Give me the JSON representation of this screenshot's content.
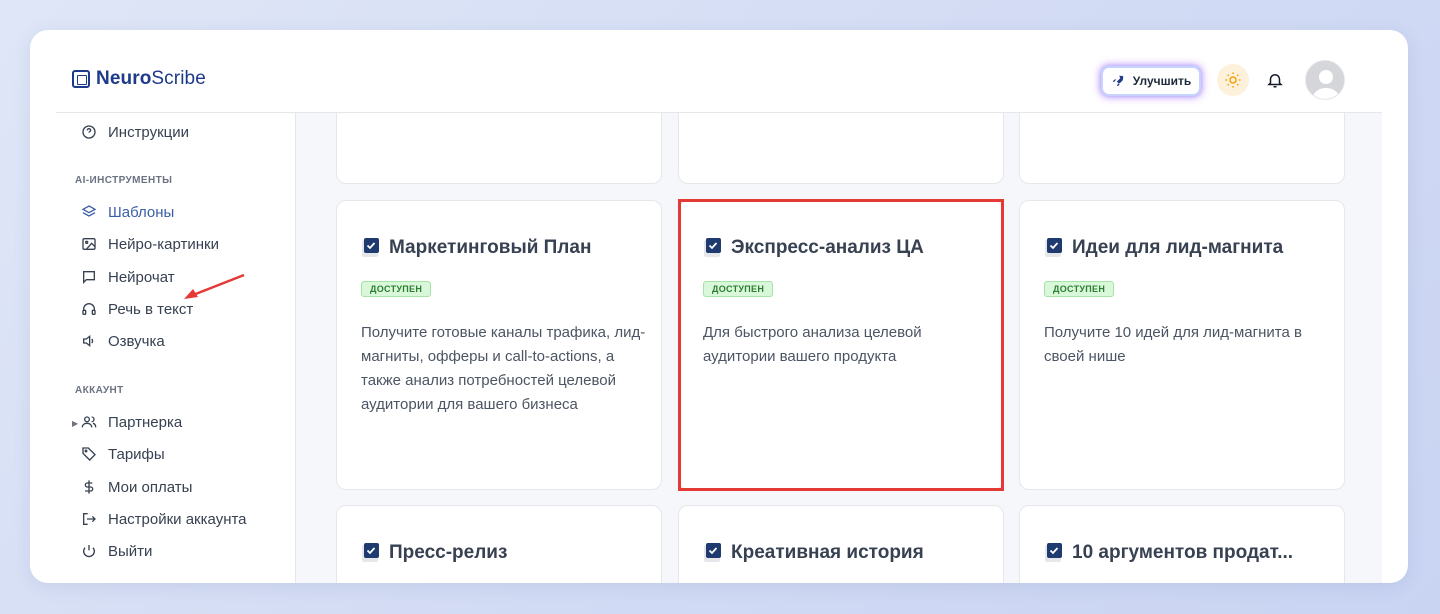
{
  "brand": {
    "name_bold": "Neuro",
    "name_light": "Scribe"
  },
  "header": {
    "upgrade_label": "Улучшить"
  },
  "sidebar": {
    "top_item": "Инструкции",
    "sections": [
      {
        "title": "AI-ИНСТРУМЕНТЫ",
        "items": [
          "Шаблоны",
          "Нейро-картинки",
          "Нейрочат",
          "Речь в текст",
          "Озвучка"
        ]
      },
      {
        "title": "АККАУНТ",
        "items": [
          "Партнерка",
          "Тарифы",
          "Мои оплаты",
          "Настройки аккаунта",
          "Выйти"
        ]
      }
    ],
    "active_item": "Шаблоны"
  },
  "cards": [
    {
      "title": "Маркетинговый План",
      "badge": "ДОСТУПЕН",
      "description": "Получите готовые каналы трафика, лид-магниты, офферы и call-to-actions, а также анализ потребностей целевой аудитории для вашего бизнеса"
    },
    {
      "title": "Экспресс-анализ ЦА",
      "badge": "ДОСТУПЕН",
      "description": "Для быстрого анализа целевой аудитории вашего продукта"
    },
    {
      "title": "Идеи для лид-магнита",
      "badge": "ДОСТУПЕН",
      "description": "Получите 10 идей для лид-магнита в своей нише"
    },
    {
      "title": "Пресс-релиз",
      "badge": "",
      "description": ""
    },
    {
      "title": "Креативная история",
      "badge": "",
      "description": ""
    },
    {
      "title": "10 аргументов продат...",
      "badge": "",
      "description": ""
    }
  ],
  "colors": {
    "accent": "#3b5ea8",
    "highlight": "#e53935",
    "badge_bg": "#d9f7d9",
    "badge_text": "#2e7d32"
  }
}
